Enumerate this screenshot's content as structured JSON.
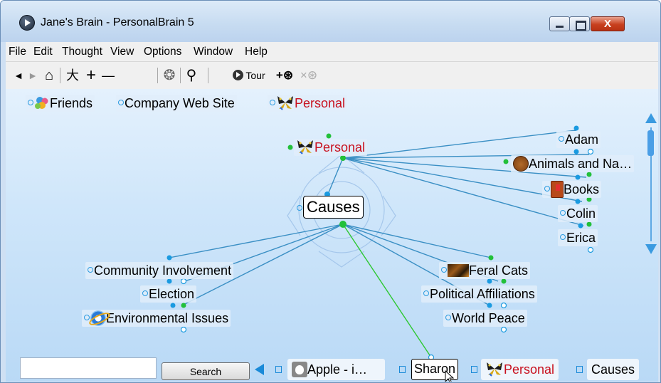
{
  "window": {
    "title": "Jane's Brain - PersonalBrain 5",
    "close_glyph": "X"
  },
  "menu": [
    "File",
    "Edit",
    "Thought",
    "View",
    "Options",
    "Window",
    "Help"
  ],
  "toolbar": {
    "back": "◄",
    "forward": "►",
    "home": "⌂",
    "layout": "⼤",
    "add": "+",
    "remove": "—",
    "settings": "❂",
    "search": "⚲",
    "tour_label": "Tour",
    "link_add": "+⊛",
    "link_remove": "×⊛"
  },
  "parents": [
    {
      "label": "Friends",
      "icon": "friends-icon"
    },
    {
      "label": "Company Web Site",
      "icon": null
    },
    {
      "label": "Personal",
      "icon": "butterfly-icon",
      "color": "#c8101e"
    }
  ],
  "plex": {
    "active": "Causes",
    "parent": "Personal",
    "jumps": [
      {
        "label": "Adam",
        "icon": null
      },
      {
        "label": "Animals and Na…",
        "icon": "bear-icon"
      },
      {
        "label": "Books",
        "icon": "book-icon"
      },
      {
        "label": "Colin",
        "icon": null
      },
      {
        "label": "Erica",
        "icon": null
      }
    ],
    "children_left": [
      {
        "label": "Community Involvement",
        "icon": null
      },
      {
        "label": "Election",
        "icon": null
      },
      {
        "label": "Environmental Issues",
        "icon": "ie-icon"
      }
    ],
    "children_right": [
      {
        "label": "Feral Cats",
        "icon": "cat-icon"
      },
      {
        "label": "Political Affiliations",
        "icon": null
      },
      {
        "label": "World Peace",
        "icon": null
      }
    ]
  },
  "bottom": {
    "search_value": "",
    "search_button": "Search",
    "pins": [
      {
        "label": "Apple - i…",
        "icon": "apple-icon"
      },
      {
        "label": "Sharon",
        "icon": null
      },
      {
        "label": "Personal",
        "icon": "butterfly-icon",
        "color": "#c8101e"
      },
      {
        "label": "Causes",
        "icon": null
      }
    ]
  },
  "colors": {
    "link_blue": "#3a8fc4",
    "link_green": "#2ec832",
    "dot_blue": "#1a9ae0",
    "dot_green": "#22c03a",
    "accent_red": "#c8101e"
  }
}
